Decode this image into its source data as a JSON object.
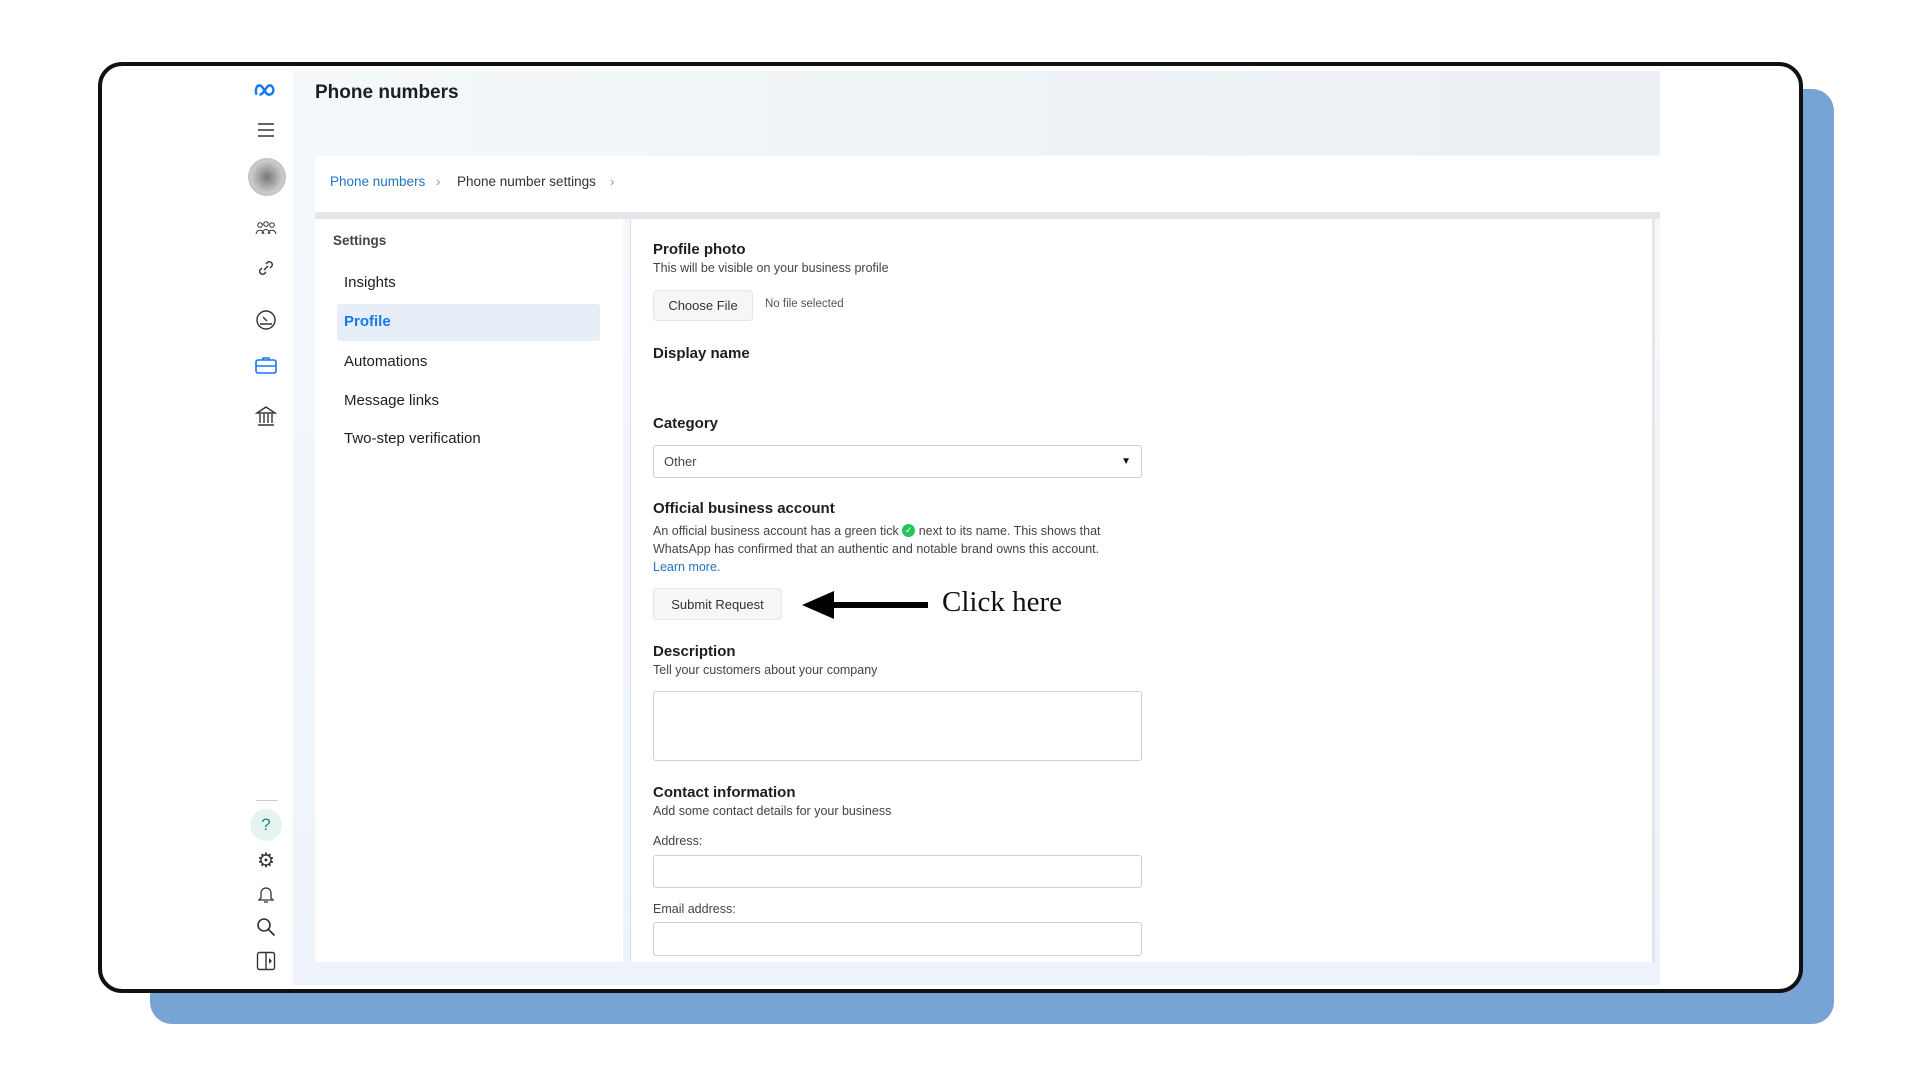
{
  "header": {
    "title": "Phone numbers"
  },
  "breadcrumb": [
    {
      "label": "Phone numbers"
    },
    {
      "label": "Phone number settings"
    }
  ],
  "settings": {
    "heading": "Settings",
    "items": [
      {
        "label": "Insights"
      },
      {
        "label": "Profile",
        "active": true
      },
      {
        "label": "Automations"
      },
      {
        "label": "Message links"
      },
      {
        "label": "Two-step verification"
      }
    ]
  },
  "rail_icons": [
    "meta-logo",
    "menu-icon",
    "avatar",
    "people-icon",
    "link-icon",
    "gauge-icon",
    "briefcase-icon",
    "bank-icon",
    "help-icon",
    "gear-icon",
    "bell-icon",
    "search-icon",
    "panel-icon"
  ],
  "form": {
    "profile_photo": {
      "title": "Profile photo",
      "subtitle": "This will be visible on your business profile",
      "button": "Choose File",
      "status": "No file selected"
    },
    "display_name": {
      "title": "Display name"
    },
    "category": {
      "title": "Category",
      "value": "Other"
    },
    "official": {
      "title": "Official business account",
      "line1_a": "An official business account has a green tick",
      "line1_b": "next to its name. This shows that",
      "line2": "WhatsApp has confirmed that an authentic and notable brand owns this account.",
      "link": "Learn more.",
      "button": "Submit Request"
    },
    "annotation": "Click here",
    "description": {
      "title": "Description",
      "subtitle": "Tell your customers about your company"
    },
    "contact": {
      "title": "Contact information",
      "subtitle": "Add some contact details for your business",
      "address_label": "Address:",
      "email_label": "Email address:"
    }
  },
  "colors": {
    "accent": "#1877f2",
    "link": "#2374c6",
    "active_bg": "#e7eef7",
    "tick": "#25c35a",
    "shadow": "#78a3d5"
  }
}
